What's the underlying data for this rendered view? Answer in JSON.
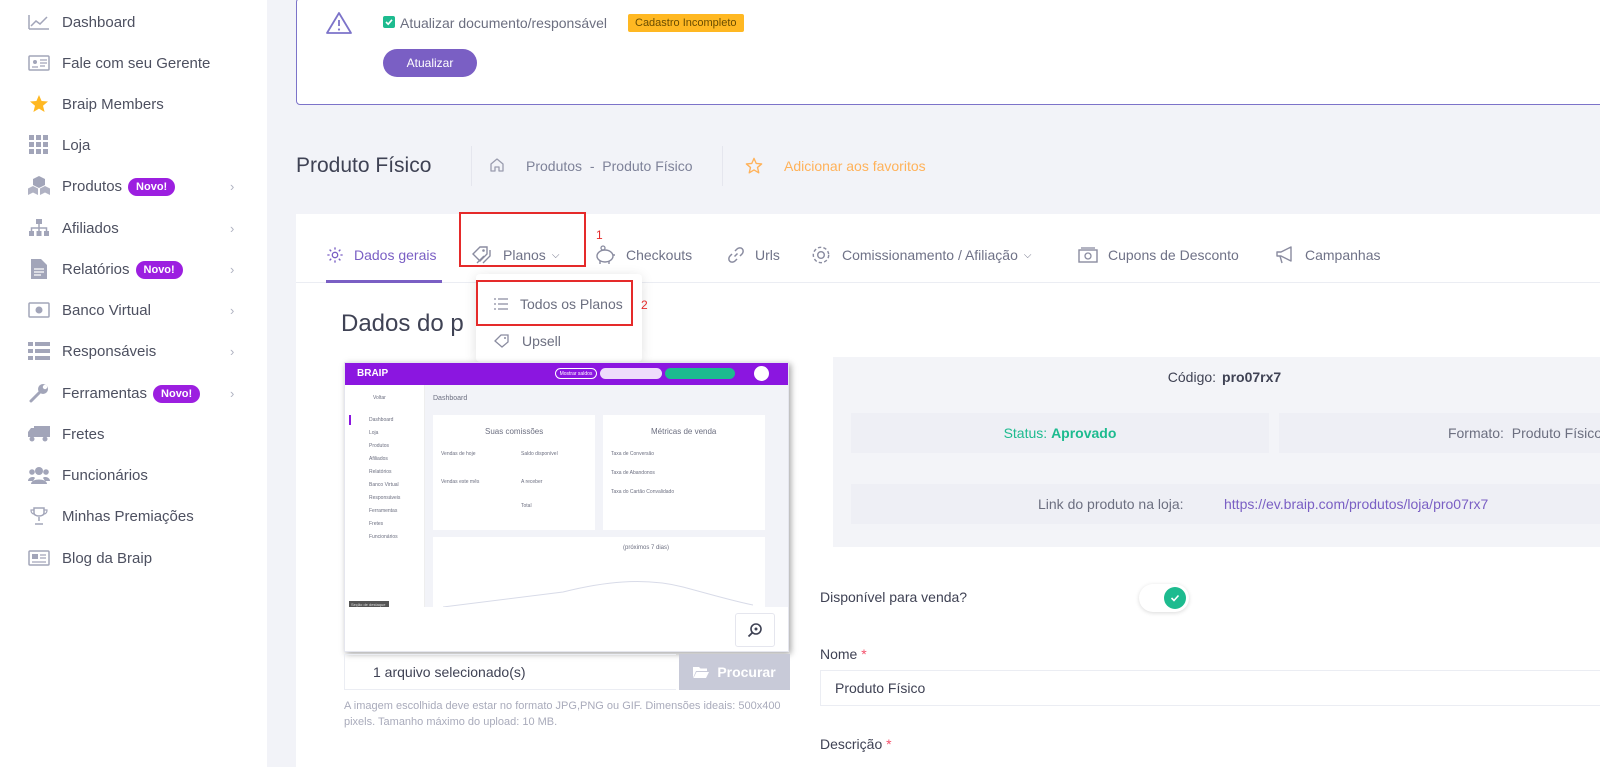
{
  "sidebar": {
    "items": [
      {
        "label": "Dashboard",
        "icon": "chart-line-icon",
        "badge": "",
        "chevron": false
      },
      {
        "label": "Fale com seu Gerente",
        "icon": "id-card-icon",
        "badge": "",
        "chevron": false
      },
      {
        "label": "Braip Members",
        "icon": "star-icon",
        "badge": "",
        "chevron": false
      },
      {
        "label": "Loja",
        "icon": "grid-icon",
        "badge": "",
        "chevron": false
      },
      {
        "label": "Produtos",
        "icon": "cubes-icon",
        "badge": "Novo!",
        "chevron": true
      },
      {
        "label": "Afiliados",
        "icon": "sitemap-icon",
        "badge": "",
        "chevron": true
      },
      {
        "label": "Relatórios",
        "icon": "file-icon",
        "badge": "Novo!",
        "chevron": true
      },
      {
        "label": "Banco Virtual",
        "icon": "money-icon",
        "badge": "",
        "chevron": true
      },
      {
        "label": "Responsáveis",
        "icon": "list-icon",
        "badge": "",
        "chevron": true
      },
      {
        "label": "Ferramentas",
        "icon": "wrench-icon",
        "badge": "Novo!",
        "chevron": true
      },
      {
        "label": "Fretes",
        "icon": "truck-icon",
        "badge": "",
        "chevron": false
      },
      {
        "label": "Funcionários",
        "icon": "users-icon",
        "badge": "",
        "chevron": false
      },
      {
        "label": "Minhas Premiações",
        "icon": "trophy-icon",
        "badge": "",
        "chevron": false
      },
      {
        "label": "Blog da Braip",
        "icon": "newspaper-icon",
        "badge": "",
        "chevron": false
      }
    ]
  },
  "alert": {
    "checkbox_label": "Atualizar documento/responsável",
    "checkbox_checked": true,
    "tag": "Cadastro Incompleto",
    "button": "Atualizar"
  },
  "subheader": {
    "title": "Produto Físico",
    "breadcrumb": [
      "Produtos",
      "-",
      "Produto Físico"
    ],
    "favorite": "Adicionar aos favoritos"
  },
  "tabs": [
    {
      "label": "Dados gerais",
      "icon": "gear-icon",
      "active": true
    },
    {
      "label": "Planos",
      "icon": "tags-icon",
      "active": false,
      "dropdown": true
    },
    {
      "label": "Checkouts",
      "icon": "piggy-bank-icon",
      "active": false
    },
    {
      "label": "Urls",
      "icon": "link-icon",
      "active": false
    },
    {
      "label": "Comissionamento / Afiliação",
      "icon": "gear-icon",
      "active": false,
      "dropdown": true
    },
    {
      "label": "Cupons de Desconto",
      "icon": "money-bill-icon",
      "active": false
    },
    {
      "label": "Campanhas",
      "icon": "bullhorn-icon",
      "active": false
    }
  ],
  "annotations": {
    "step1": "1",
    "step2": "2"
  },
  "planos_menu": [
    {
      "label": "Todos os Planos",
      "icon": "list-icon"
    },
    {
      "label": "Upsell",
      "icon": "tag-icon"
    }
  ],
  "section": {
    "title": "Dados do p"
  },
  "preview": {
    "logo": "BRAIP",
    "menu_button": "Mostrar saldos",
    "side_items": [
      "Voltar",
      "Dashboard",
      "Loja",
      "Produtos",
      "Afiliados",
      "Relatórios",
      "Banco Virtual",
      "Responsáveis",
      "Ferramentas",
      "Fretes",
      "Funcionários"
    ],
    "main_title": "Dashboard",
    "card1_title": "Suas comissões",
    "card1_rows": [
      "Vendas de hoje",
      "Saldo disponível",
      "Vendas este mês",
      "A receber",
      "Total"
    ],
    "card2_title": "Métricas de venda",
    "card2_rows": [
      "Taxa de Conversão",
      "Taxa de Abandonos",
      "Taxa do Cartão Convalidado"
    ],
    "chart_title": "(próximos 7 dias)",
    "footer_tag": "Seção de destaque"
  },
  "upload": {
    "file_text": "1 arquivo selecionado(s)",
    "button": "Procurar",
    "hint": "A imagem escolhida deve estar no formato JPG,PNG ou GIF. Dimensões ideais: 500x400 pixels. Tamanho máximo do upload: 10 MB."
  },
  "info": {
    "code_label": "Código:",
    "code_value": "pro07rx7",
    "status_label": "Status:",
    "status_value": "Aprovado",
    "formato_label": "Formato:",
    "formato_value": "Produto Físico",
    "link_label": "Link do produto na loja:",
    "link_value": "https://ev.braip.com/produtos/loja/pro07rx7"
  },
  "form": {
    "available_label": "Disponível para venda?",
    "available": true,
    "nome_label": "Nome",
    "nome_value": "Produto Físico",
    "descricao_label": "Descrição",
    "required_mark": "*"
  },
  "colors": {
    "primary": "#7a5fc4",
    "success": "#1dbb8f",
    "warning": "#ffb822",
    "badge": "#9c1fe0",
    "highlight": "#e52a2a"
  }
}
